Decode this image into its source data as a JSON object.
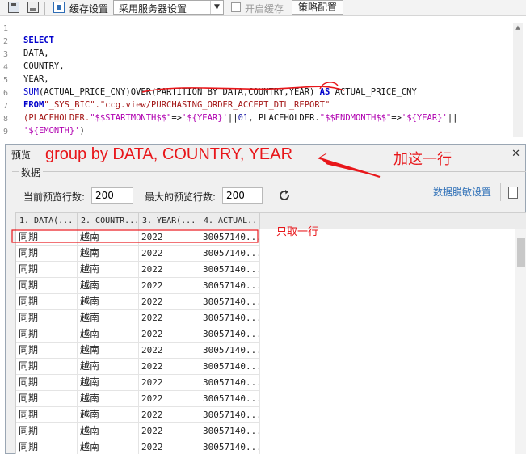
{
  "toolbar": {
    "cache_settings_label": "缓存设置",
    "server_setting_value": "采用服务器设置",
    "enable_cache_label": "开启缓存",
    "strategy_button": "策略配置"
  },
  "editor": {
    "line_numbers": [
      "1",
      "2",
      "3",
      "4",
      "5",
      "6",
      "7",
      "8",
      "9"
    ],
    "lines": {
      "l2": "SELECT",
      "l3": "DATA,",
      "l4": "COUNTRY,",
      "l5": "YEAR,",
      "l6_fn": "SUM",
      "l6_arg": "(ACTUAL_PRICE_CNY)",
      "l6_over": "OVER(PARTITION BY DATA,COUNTRY,YEAR)",
      "l6_as": " AS",
      "l6_alias": " ACTUAL_PRICE_CNY",
      "l7_from": "FROM",
      "l7_schema": "\"_SYS_BIC\".",
      "l7_view": "\"ccg.view/PURCHASING_ORDER_ACCEPT_DTL_REPORT\"",
      "l8_a": "(PLACEHOLDER.",
      "l8_b": "\"$$STARTMONTH$$\"",
      "l8_c": "=>",
      "l8_d": "'${YEAR}'",
      "l8_e": "||",
      "l8_f": "01",
      "l8_g": ", PLACEHOLDER.",
      "l8_h": "\"$$ENDMONTH$$\"",
      "l8_i": "=>",
      "l8_j": "'${YEAR}'",
      "l8_k": "||",
      "l9_a": "'${EMONTH}'",
      "l9_b": ")"
    }
  },
  "preview": {
    "title": "预览",
    "close": "✕",
    "group_label": "数据",
    "current_rows_label": "当前预览行数:",
    "current_rows_value": "200",
    "max_rows_label": "最大的预览行数:",
    "max_rows_value": "200",
    "mask_settings_link": "数据脱敏设置"
  },
  "grid": {
    "headers": [
      "1. DATA(...",
      "2. COUNTR...",
      "3. YEAR(...",
      "4. ACTUAL..."
    ],
    "rows": [
      [
        "同期",
        "越南",
        "2022",
        "30057140...."
      ],
      [
        "同期",
        "越南",
        "2022",
        "30057140...."
      ],
      [
        "同期",
        "越南",
        "2022",
        "30057140...."
      ],
      [
        "同期",
        "越南",
        "2022",
        "30057140...."
      ],
      [
        "同期",
        "越南",
        "2022",
        "30057140...."
      ],
      [
        "同期",
        "越南",
        "2022",
        "30057140...."
      ],
      [
        "同期",
        "越南",
        "2022",
        "30057140...."
      ],
      [
        "同期",
        "越南",
        "2022",
        "30057140...."
      ],
      [
        "同期",
        "越南",
        "2022",
        "30057140...."
      ],
      [
        "同期",
        "越南",
        "2022",
        "30057140...."
      ],
      [
        "同期",
        "越南",
        "2022",
        "30057140...."
      ],
      [
        "同期",
        "越南",
        "2022",
        "30057140...."
      ],
      [
        "同期",
        "越南",
        "2022",
        "30057140...."
      ],
      [
        "同期",
        "越南",
        "2022",
        "30057140...."
      ]
    ]
  },
  "annotations": {
    "group_by": "group by DATA, COUNTRY, YEAR",
    "add_line": "加这一行",
    "only_one_row": "只取一行",
    "color": "#e8161a"
  }
}
